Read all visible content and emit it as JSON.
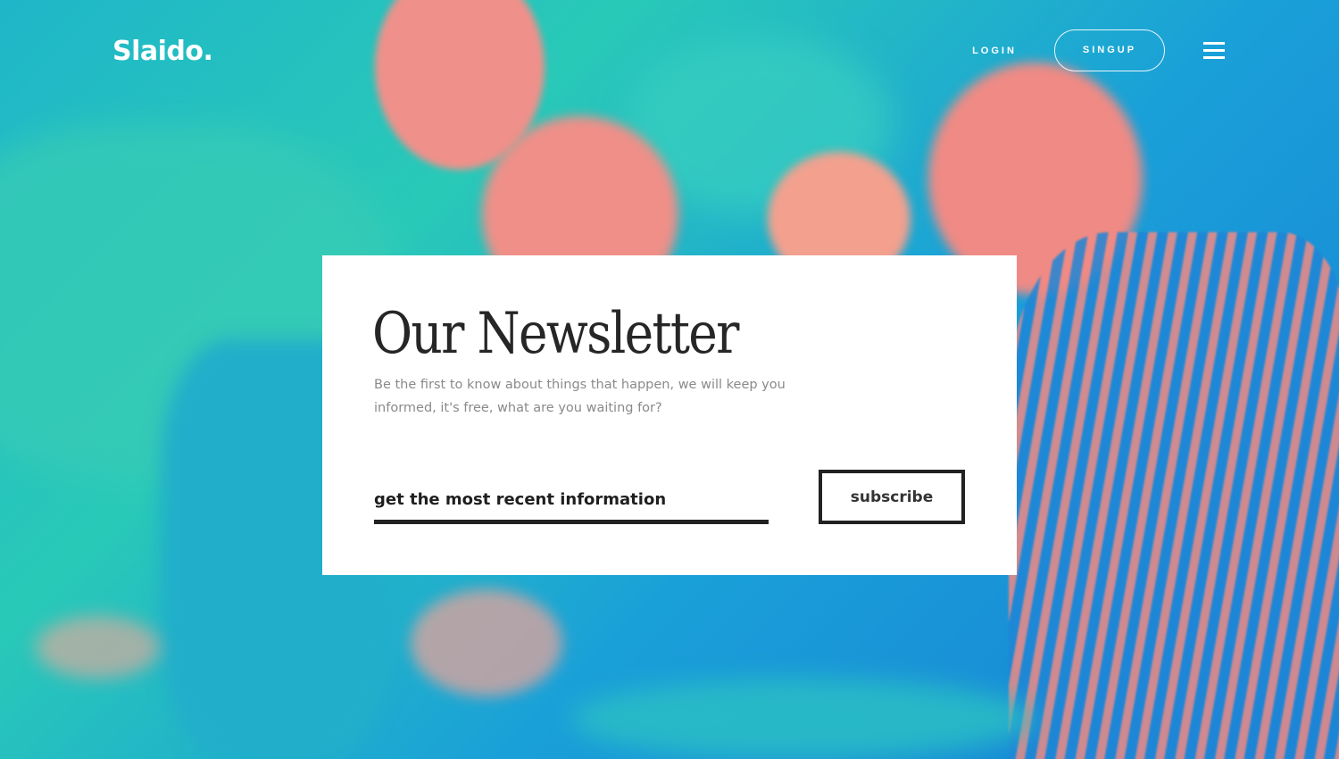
{
  "header": {
    "logo_text": "Slaido.",
    "login_label": "LOGIN",
    "signup_label": "SINGUP",
    "menu_icon": "hamburger-menu-icon"
  },
  "newsletter": {
    "title": "Our Newsletter",
    "description": "Be the first to know about things that happen, we will keep you informed, it's free, what are you waiting for?",
    "input_placeholder": "get the most recent information",
    "subscribe_label": "subscribe"
  },
  "colors": {
    "background_primary": "#1fb6c9",
    "background_secondary": "#1780d6",
    "photo_duotone_highlight": "#f08a84",
    "card_background": "#ffffff",
    "title_text": "#262626",
    "description_text": "#8a8a8a",
    "button_border": "#222222"
  }
}
